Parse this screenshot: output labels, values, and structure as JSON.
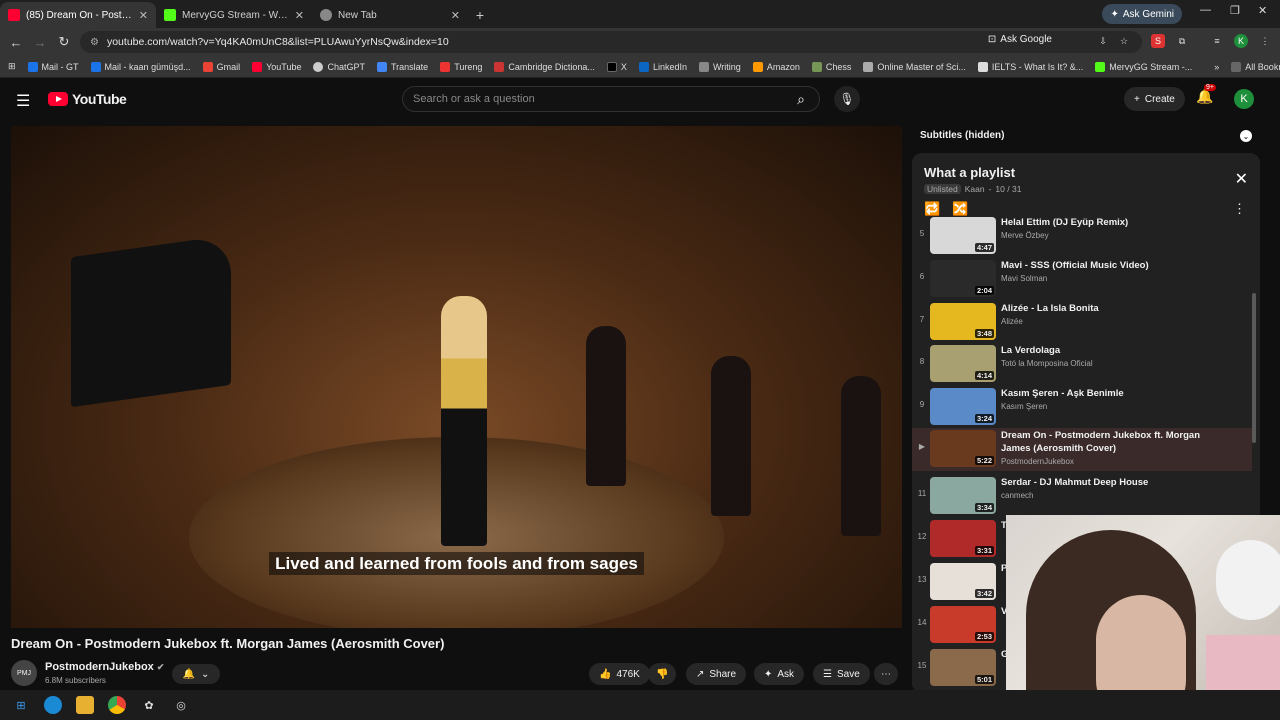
{
  "browser": {
    "tabs": [
      {
        "title": "(85) Dream On - Postmode",
        "active": true
      },
      {
        "title": "MervyGG Stream - Watch Live",
        "active": false
      },
      {
        "title": "New Tab",
        "active": false
      }
    ],
    "gemini_label": "Ask Gemini",
    "url": "youtube.com/watch?v=Yq4KA0mUnC8&list=PLUAwuYyrNsQw&index=10",
    "ask_google": "Ask Google",
    "bookmarks": [
      "Mail - GT",
      "Mail - kaan gümüşd...",
      "Gmail",
      "YouTube",
      "ChatGPT",
      "Translate",
      "Tureng",
      "Cambridge Dictiona...",
      "X",
      "LinkedIn",
      "Writing",
      "Amazon",
      "Chess",
      "Online Master of Sci...",
      "IELTS - What Is It? &...",
      "MervyGG Stream -..."
    ],
    "all_bookmarks": "All Bookmarks"
  },
  "yt": {
    "logo_text": "YouTube",
    "search_placeholder": "Search or ask a question",
    "create_label": "Create",
    "notif_count": "9+",
    "avatar_letter": "K"
  },
  "video": {
    "subtitle": "Lived and learned from fools and from sages",
    "title": "Dream On - Postmodern Jukebox ft. Morgan James (Aerosmith Cover)",
    "channel": "PostmodernJukebox",
    "subscribers": "6.8M subscribers",
    "likes": "476K",
    "share": "Share",
    "ask": "Ask",
    "save": "Save"
  },
  "sidebar": {
    "subtitles": "Subtitles (hidden)",
    "playlist_title": "What a playlist",
    "unlisted": "Unlisted",
    "owner": "Kaan",
    "position": "10 / 31",
    "items": [
      {
        "idx": "5",
        "title": "Helal Ettim (DJ Eyüp Remix)",
        "artist": "Merve Özbey",
        "dur": "4:47",
        "color": "#d8d8d8"
      },
      {
        "idx": "6",
        "title": "Mavi - SSS (Official Music Video)",
        "artist": "Mavi Solman",
        "dur": "2:04",
        "color": "#2a2a2a"
      },
      {
        "idx": "7",
        "title": "Alizée - La Isla Bonita",
        "artist": "Alizée",
        "dur": "3:48",
        "color": "#e6b820"
      },
      {
        "idx": "8",
        "title": "La Verdolaga",
        "artist": "Totó la Momposina Oficial",
        "dur": "4:14",
        "color": "#a8a070"
      },
      {
        "idx": "9",
        "title": "Kasım Şeren - Aşk Benimle",
        "artist": "Kasım Şeren",
        "dur": "3:24",
        "color": "#5a8ac8"
      },
      {
        "idx": "▶",
        "title": "Dream On - Postmodern Jukebox ft. Morgan James (Aerosmith Cover)",
        "artist": "PostmodernJukebox",
        "dur": "5:22",
        "color": "#6a3a1e",
        "current": true
      },
      {
        "idx": "11",
        "title": "Serdar - DJ Mahmut Deep House",
        "artist": "canmech",
        "dur": "3:34",
        "color": "#8aa8a0"
      },
      {
        "idx": "12",
        "title": "T",
        "artist": "",
        "dur": "3:31",
        "color": "#b02a2a"
      },
      {
        "idx": "13",
        "title": "P",
        "artist": "",
        "dur": "3:42",
        "color": "#e6e0d8"
      },
      {
        "idx": "14",
        "title": "V",
        "artist": "",
        "dur": "2:53",
        "color": "#c83a2a"
      },
      {
        "idx": "15",
        "title": "G",
        "artist": "",
        "dur": "5:01",
        "color": "#8a6a4a"
      }
    ]
  }
}
